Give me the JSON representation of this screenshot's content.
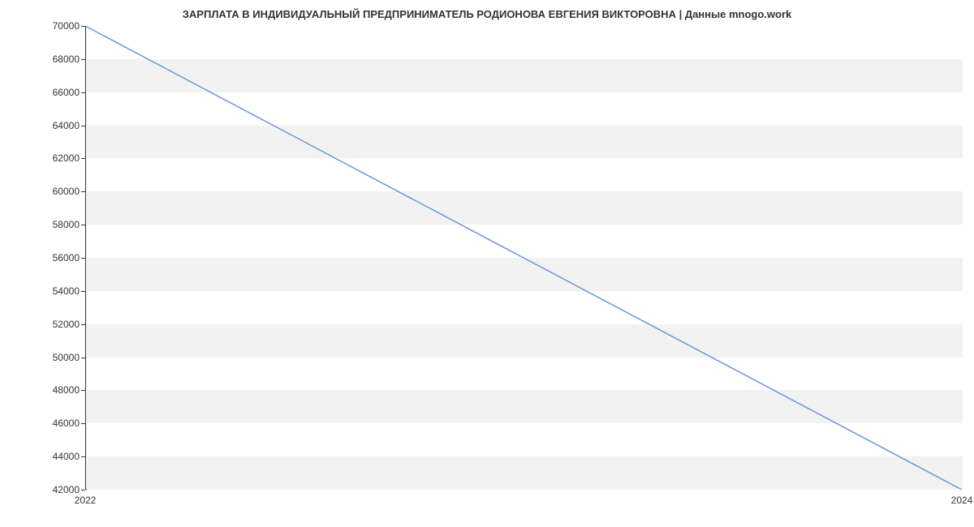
{
  "chart_data": {
    "type": "line",
    "title": "ЗАРПЛАТА В ИНДИВИДУАЛЬНЫЙ ПРЕДПРИНИМАТЕЛЬ РОДИОНОВА ЕВГЕНИЯ ВИКТОРОВНА | Данные mnogo.work",
    "x": [
      2022,
      2024
    ],
    "values": [
      70000,
      42000
    ],
    "xlabel": "",
    "ylabel": "",
    "x_ticks": [
      2022,
      2024
    ],
    "y_ticks": [
      42000,
      44000,
      46000,
      48000,
      50000,
      52000,
      54000,
      56000,
      58000,
      60000,
      62000,
      64000,
      66000,
      68000,
      70000
    ],
    "xlim": [
      2022,
      2024
    ],
    "ylim": [
      42000,
      70000
    ],
    "line_color": "#6699dd",
    "grid": "alternating-bands"
  }
}
